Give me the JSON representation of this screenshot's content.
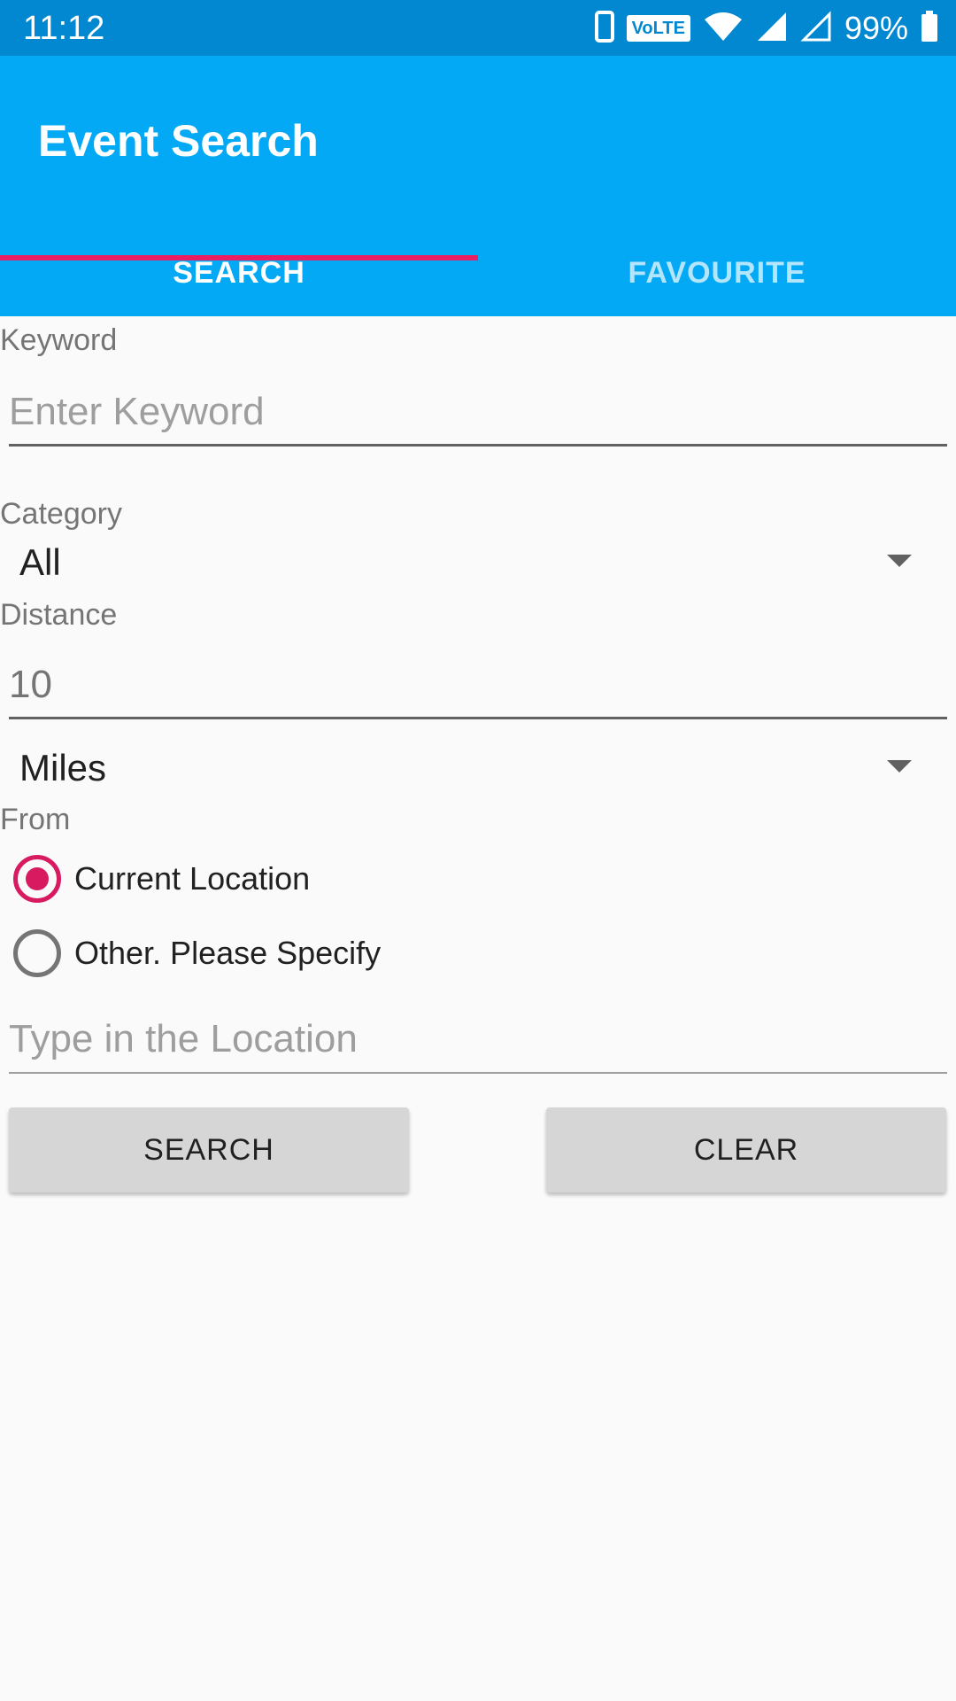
{
  "status_bar": {
    "time": "11:12",
    "volte": "VoLTE",
    "battery": "99%"
  },
  "app": {
    "title": "Event Search"
  },
  "tabs": [
    {
      "label": "SEARCH",
      "selected": true
    },
    {
      "label": "FAVOURITE",
      "selected": false
    }
  ],
  "form": {
    "keyword_label": "Keyword",
    "keyword_placeholder": "Enter Keyword",
    "keyword_value": "",
    "category_label": "Category",
    "category_selected": "All",
    "distance_label": "Distance",
    "distance_placeholder": "10",
    "distance_value": "",
    "unit_selected": "Miles",
    "from_label": "From",
    "radio_current": "Current Location",
    "radio_other": "Other. Please Specify",
    "radio_selected": "Current Location",
    "location_placeholder": "Type in the Location",
    "location_value": ""
  },
  "buttons": {
    "search": "SEARCH",
    "clear": "CLEAR"
  },
  "colors": {
    "status_bar": "#0288d1",
    "app_bar": "#03a9f4",
    "accent": "#e91e63",
    "radio_checked": "#d81b60",
    "button_bg": "#d6d6d6"
  },
  "icons": [
    "phone-icon",
    "volte-icon",
    "wifi-icon",
    "signal-full-icon",
    "signal-empty-icon",
    "battery-icon"
  ]
}
